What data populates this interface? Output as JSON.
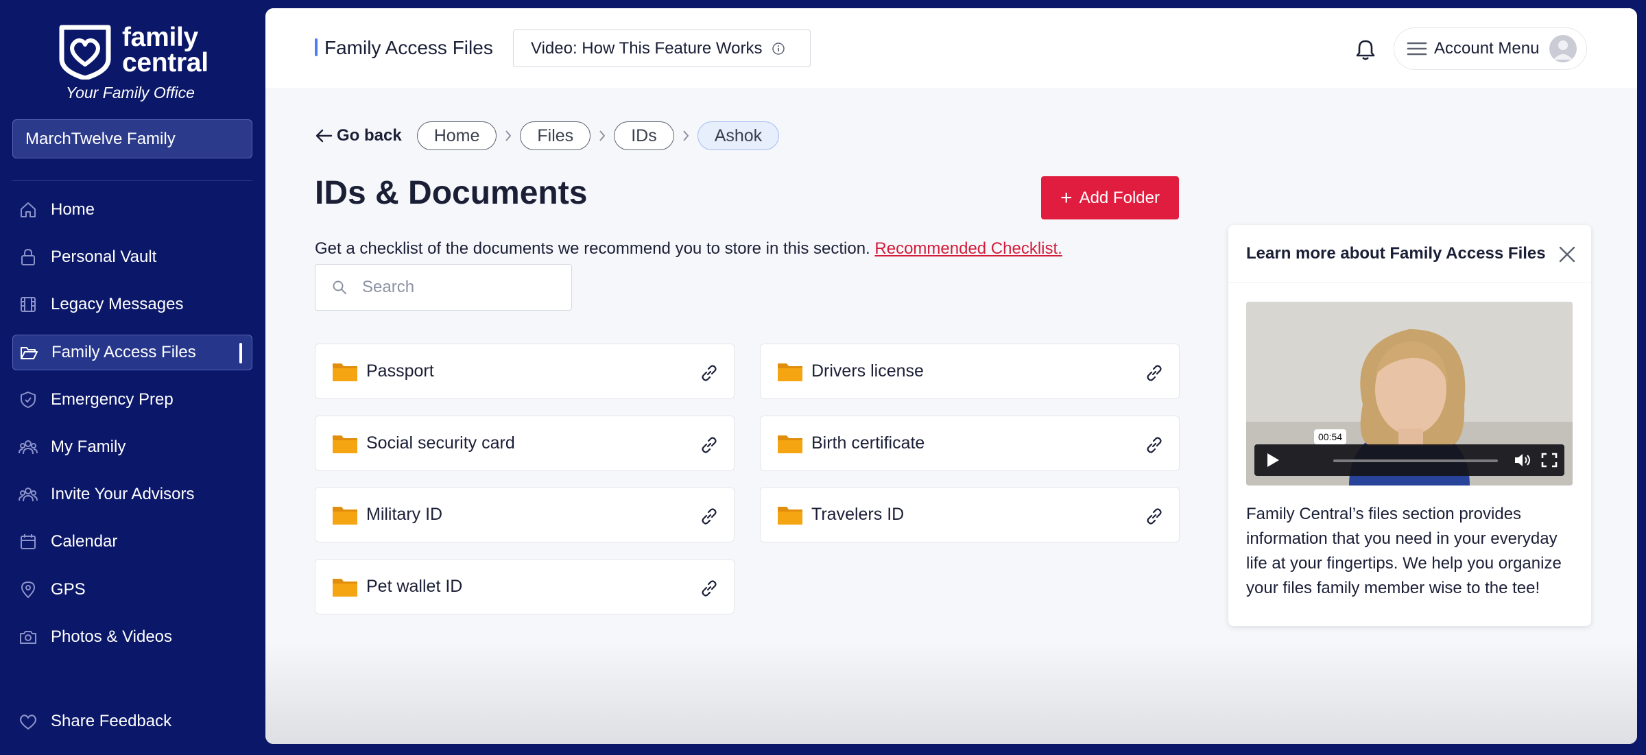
{
  "brand": {
    "name_line1": "family",
    "name_line2": "central",
    "tagline": "Your Family Office"
  },
  "sidebar": {
    "family_selector": "MarchTwelve Family",
    "items": [
      {
        "label": "Home",
        "icon": "home-icon"
      },
      {
        "label": "Personal Vault",
        "icon": "lock-icon"
      },
      {
        "label": "Legacy Messages",
        "icon": "film-icon"
      },
      {
        "label": "Family Access Files",
        "icon": "folder-open-icon",
        "active": true
      },
      {
        "label": "Emergency Prep",
        "icon": "shield-icon"
      },
      {
        "label": "My Family",
        "icon": "users-icon"
      },
      {
        "label": "Invite Your Advisors",
        "icon": "users-icon"
      },
      {
        "label": "Calendar",
        "icon": "calendar-icon"
      },
      {
        "label": "GPS",
        "icon": "map-pin-icon"
      },
      {
        "label": "Photos & Videos",
        "icon": "camera-icon"
      }
    ],
    "feedback": "Share Feedback"
  },
  "header": {
    "title": "Family Access Files",
    "video_button": "Video: How This Feature Works",
    "account_menu": "Account Menu"
  },
  "breadcrumb": {
    "back": "Go back",
    "items": [
      "Home",
      "Files",
      "IDs",
      "Ashok"
    ]
  },
  "page": {
    "title": "IDs & Documents",
    "add_folder": "Add Folder",
    "description": "Get a checklist of the documents we recommend you to store in this section. ",
    "checklist_link": "Recommended Checklist.",
    "search_placeholder": "Search"
  },
  "folders": [
    "Passport",
    "Drivers license",
    "Social security card",
    "Birth certificate",
    "Military ID",
    "Travelers ID",
    "Pet wallet ID"
  ],
  "learn_more": {
    "title": "Learn more about Family Access Files",
    "video_time": "00:54",
    "text": "Family Central’s files section provides information that you need in your everyday life at your fingertips. We help you organize your files family member wise to the tee!"
  },
  "colors": {
    "sidebar_bg": "#0b1769",
    "accent_red": "#e11d3f",
    "link_red": "#d21c3a",
    "folder_orange": "#f5a511",
    "active_crumb_bg": "#e7eefc"
  }
}
